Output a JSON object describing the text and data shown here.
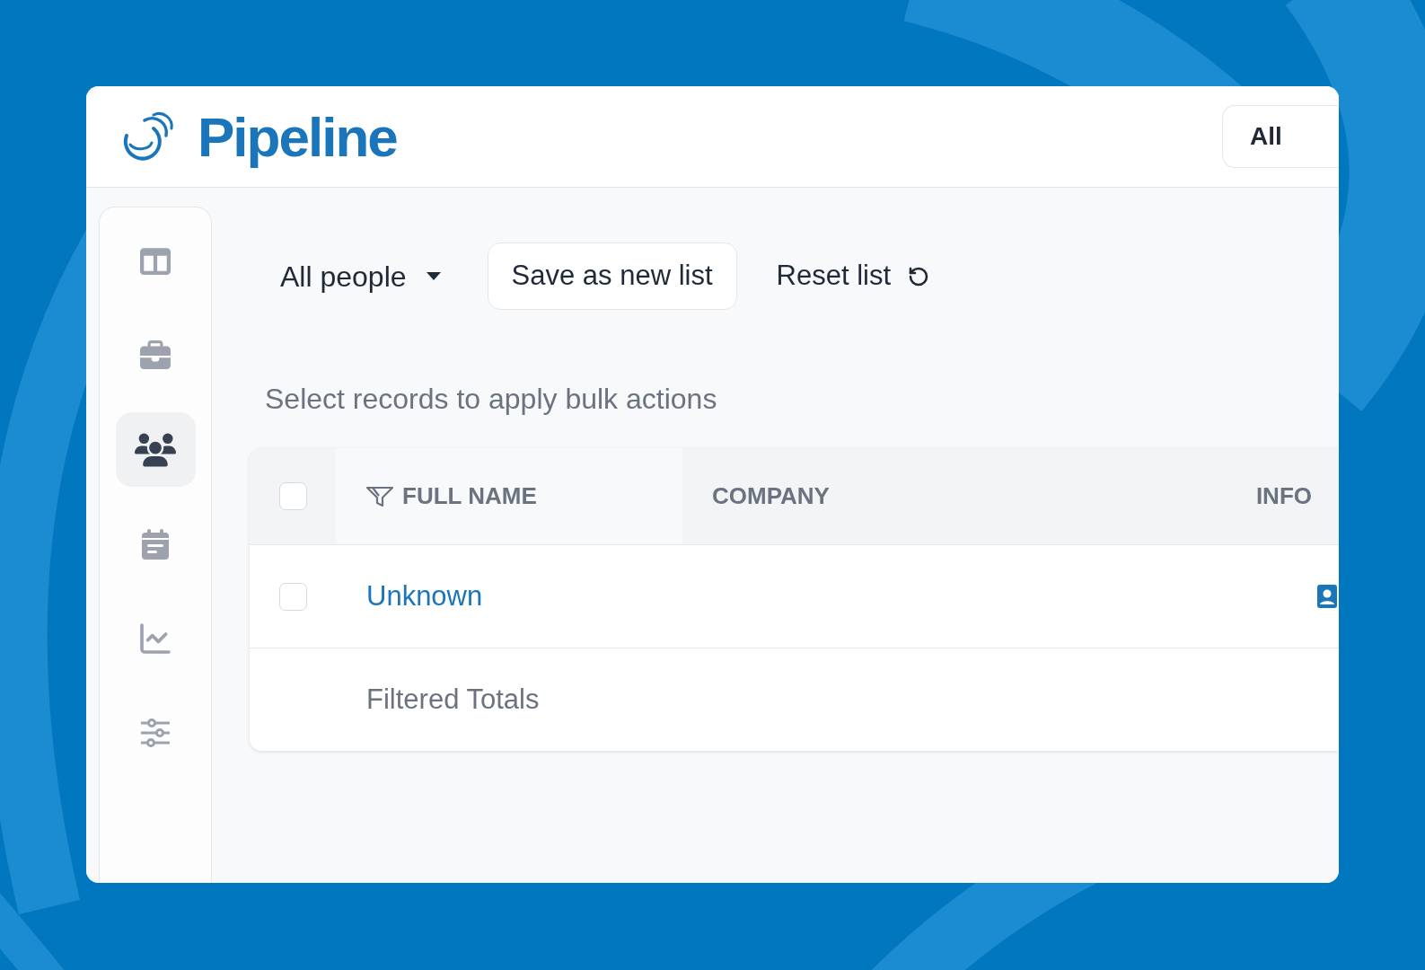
{
  "brand": {
    "name": "Pipeline"
  },
  "header": {
    "scope_button": "All"
  },
  "sidebar": {
    "items": [
      {
        "kind": "columns",
        "selected": false
      },
      {
        "kind": "briefcase",
        "selected": false
      },
      {
        "kind": "people",
        "selected": true
      },
      {
        "kind": "calendar",
        "selected": false
      },
      {
        "kind": "chart",
        "selected": false
      },
      {
        "kind": "sliders",
        "selected": false
      }
    ]
  },
  "toolbar": {
    "list_menu": "All people",
    "save_button": "Save as new list",
    "reset_button": "Reset list"
  },
  "hint": "Select records to apply bulk actions",
  "table": {
    "header_checkbox": {
      "checked": false
    },
    "columns": [
      {
        "label": "FULL NAME",
        "filtered": true
      },
      {
        "label": "COMPANY",
        "filtered": false
      },
      {
        "label": "INFO",
        "filtered": false
      }
    ],
    "rows": [
      {
        "checked": false,
        "full_name": "Unknown"
      }
    ],
    "footer": "Filtered Totals"
  }
}
